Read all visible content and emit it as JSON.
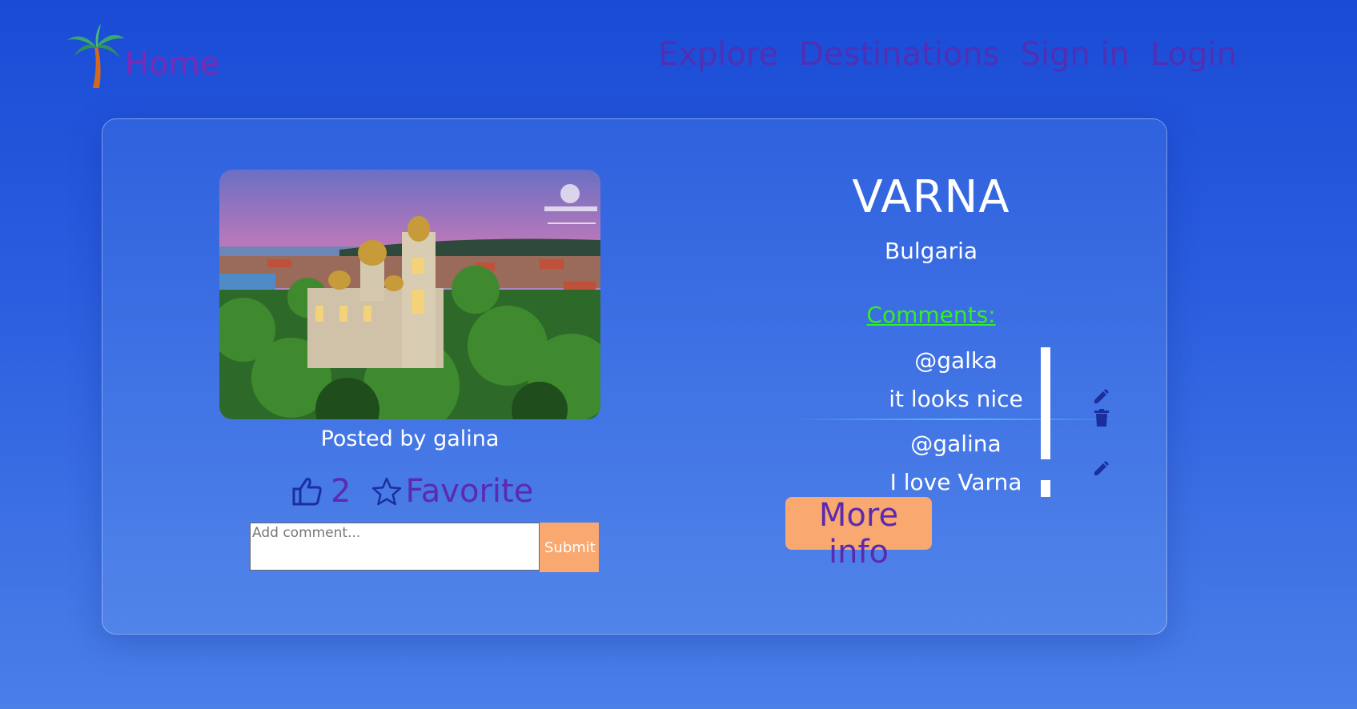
{
  "nav": {
    "home": "Home",
    "links": [
      "Explore",
      "Destinations",
      "Sign in",
      "Login"
    ]
  },
  "destination": {
    "name": "VARNA",
    "country": "Bulgaria",
    "posted_by": "Posted by galina",
    "likes": "2",
    "favorite_label": "Favorite"
  },
  "comment_form": {
    "placeholder": "Add comment...",
    "submit": "Submit"
  },
  "comments": {
    "heading": "Comments:",
    "items": [
      {
        "user": "@galka",
        "text": "it looks nice"
      },
      {
        "user": "@galina",
        "text": "I love Varna"
      }
    ]
  },
  "more_info": "More info",
  "colors": {
    "accent": "#5b2ab0",
    "button": "#f9a86f",
    "comments_heading": "#33ee22"
  }
}
